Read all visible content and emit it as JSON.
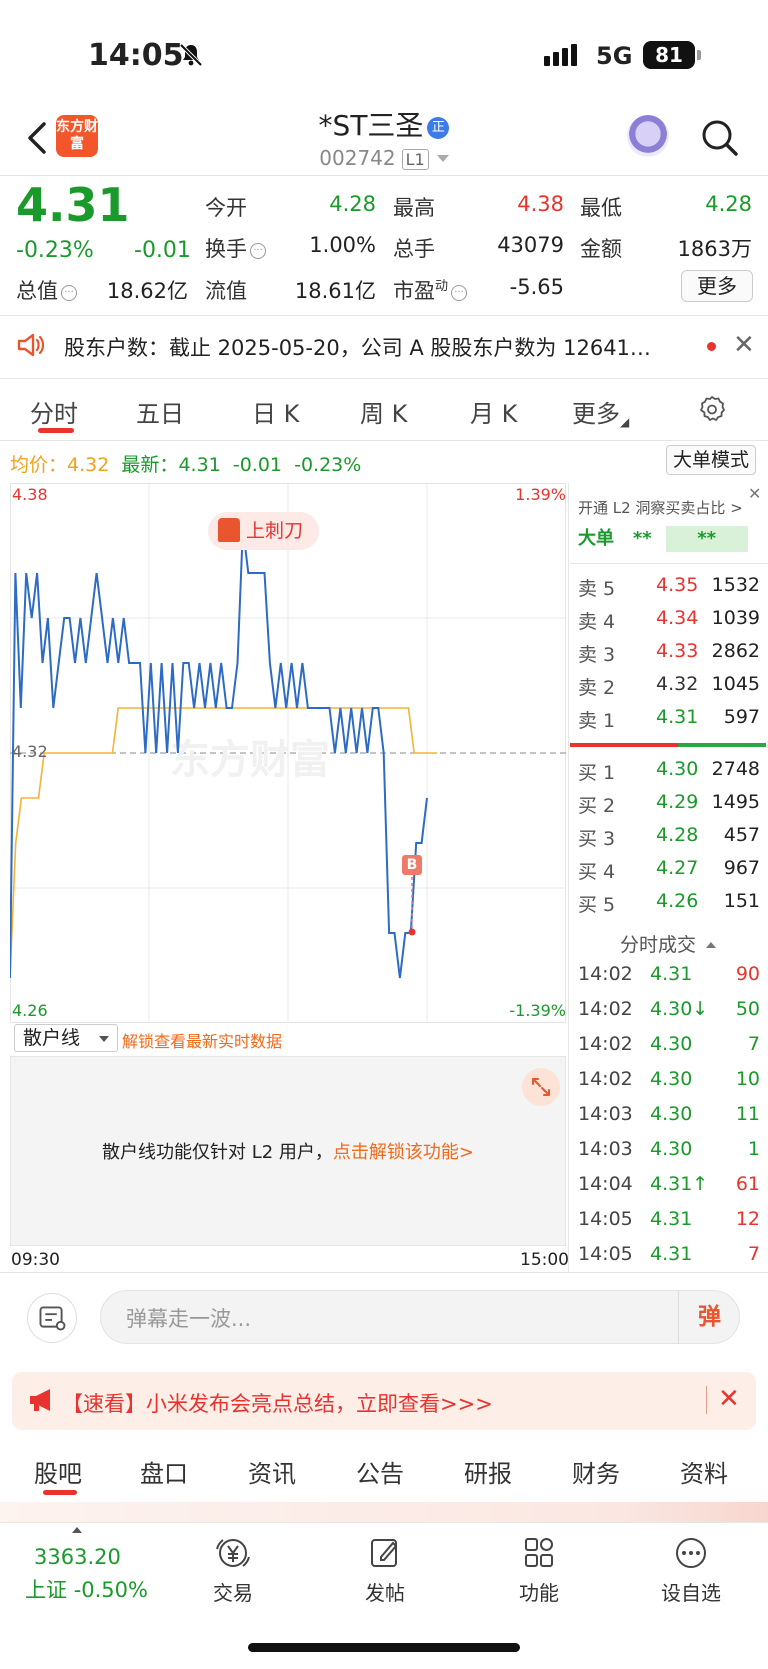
{
  "status_bar": {
    "time": "14:05",
    "network": "5G",
    "battery": "81"
  },
  "header": {
    "app_logo": "东方财富",
    "stock_name": "*ST三圣",
    "badge": "正",
    "stock_code": "002742",
    "level": "L1"
  },
  "quote": {
    "price": "4.31",
    "change_pct": "-0.23%",
    "change_abs": "-0.01",
    "open_label": "今开",
    "open": "4.28",
    "high_label": "最高",
    "high": "4.38",
    "low_label": "最低",
    "low": "4.28",
    "turnover_label": "换手",
    "turnover": "1.00%",
    "volume_label": "总手",
    "volume": "43079",
    "amount_label": "金额",
    "amount": "1863万",
    "mktcap_label": "总值",
    "mktcap": "18.62亿",
    "float_label": "流值",
    "float_cap": "18.61亿",
    "pe_label": "市盈",
    "pe_sup": "动",
    "pe": "-5.65",
    "more_label": "更多"
  },
  "notice": {
    "text": "股东户数：截止 2025-05-20，公司 A 股股东户数为 12641…"
  },
  "chart_tabs": [
    "分时",
    "五日",
    "日 K",
    "周 K",
    "月 K",
    "更多"
  ],
  "chart_header": {
    "avg_label": "均价：",
    "avg_value": "4.32",
    "latest_label": "最新：",
    "latest_value": "4.31",
    "latest_change": "-0.01",
    "latest_pct": "-0.23%",
    "big_order_mode": "大单模式"
  },
  "chart_data": {
    "type": "line",
    "y_high_label": "4.38",
    "y_low_label": "4.26",
    "y_mid_label": "4.32",
    "pct_high_label": "1.39%",
    "pct_low_label": "-1.39%",
    "ylim": [
      4.26,
      4.38
    ],
    "x_start_label": "09:30",
    "x_end_label": "15:00",
    "pattern_tag": "上刺刀",
    "marker_label": "B",
    "watermark": "东方财富",
    "series": [
      {
        "values": [
          4.27,
          4.36,
          4.33,
          4.36,
          4.35,
          4.36,
          4.34,
          4.35,
          4.33,
          4.34,
          4.35,
          4.35,
          4.34,
          4.35,
          4.34,
          4.35,
          4.36,
          4.35,
          4.34,
          4.35,
          4.34,
          4.35,
          4.34,
          4.34,
          4.34,
          4.32,
          4.34,
          4.32,
          4.34,
          4.32,
          4.34,
          4.32,
          4.34,
          4.34,
          4.33,
          4.34,
          4.33,
          4.34,
          4.33,
          4.34,
          4.33,
          4.33,
          4.34,
          4.37,
          4.36,
          4.36,
          4.36,
          4.36,
          4.34,
          4.33,
          4.34,
          4.33,
          4.34,
          4.33,
          4.34,
          4.33,
          4.33,
          4.33,
          4.33,
          4.33,
          4.32,
          4.33,
          4.32,
          4.33,
          4.32,
          4.33,
          4.32,
          4.33,
          4.33,
          4.32,
          4.28,
          4.28,
          4.27,
          4.28,
          4.28,
          4.3,
          4.3,
          4.31
        ]
      },
      {
        "values": [
          4.27,
          4.3,
          4.31,
          4.31,
          4.31,
          4.31,
          4.32,
          4.32,
          4.32,
          4.32,
          4.32,
          4.32,
          4.32,
          4.32,
          4.32,
          4.32,
          4.32,
          4.32,
          4.32,
          4.33,
          4.33,
          4.33,
          4.33,
          4.33,
          4.33,
          4.33,
          4.33,
          4.33,
          4.33,
          4.33,
          4.33,
          4.33,
          4.33,
          4.33,
          4.33,
          4.33,
          4.33,
          4.33,
          4.33,
          4.33,
          4.33,
          4.33,
          4.33,
          4.33,
          4.33,
          4.33,
          4.33,
          4.33,
          4.33,
          4.33,
          4.33,
          4.33,
          4.33,
          4.33,
          4.33,
          4.33,
          4.33,
          4.33,
          4.33,
          4.33,
          4.33,
          4.33,
          4.33,
          4.33,
          4.33,
          4.33,
          4.33,
          4.33,
          4.33,
          4.33,
          4.33,
          4.32,
          4.32,
          4.32,
          4.32,
          4.32
        ]
      }
    ]
  },
  "retail_line": {
    "select_label": "散户线",
    "unlock_hint": "解锁查看最新实时数据",
    "message": "散户线功能仅针对 L2 用户，",
    "message_link": "点击解锁该功能>"
  },
  "l2": {
    "title": "开通 L2 洞察买卖占比 >",
    "big_label": "大单",
    "big_a": "**",
    "big_b": "**"
  },
  "order_book": {
    "asks": [
      {
        "label": "卖 5",
        "price": "4.35",
        "vol": "1532"
      },
      {
        "label": "卖 4",
        "price": "4.34",
        "vol": "1039"
      },
      {
        "label": "卖 3",
        "price": "4.33",
        "vol": "2862"
      },
      {
        "label": "卖 2",
        "price": "4.32",
        "vol": "1045"
      },
      {
        "label": "卖 1",
        "price": "4.31",
        "vol": "597"
      }
    ],
    "bids": [
      {
        "label": "买 1",
        "price": "4.30",
        "vol": "2748"
      },
      {
        "label": "买 2",
        "price": "4.29",
        "vol": "1495"
      },
      {
        "label": "买 3",
        "price": "4.28",
        "vol": "457"
      },
      {
        "label": "买 4",
        "price": "4.27",
        "vol": "967"
      },
      {
        "label": "买 5",
        "price": "4.26",
        "vol": "151"
      }
    ]
  },
  "ticks": {
    "title": "分时成交",
    "rows": [
      {
        "time": "14:02",
        "price": "4.31",
        "vol": "90"
      },
      {
        "time": "14:02",
        "price": "4.30↓",
        "vol": "50"
      },
      {
        "time": "14:02",
        "price": "4.30",
        "vol": "7"
      },
      {
        "time": "14:02",
        "price": "4.30",
        "vol": "10"
      },
      {
        "time": "14:03",
        "price": "4.30",
        "vol": "11"
      },
      {
        "time": "14:03",
        "price": "4.30",
        "vol": "1"
      },
      {
        "time": "14:04",
        "price": "4.31↑",
        "vol": "61"
      },
      {
        "time": "14:05",
        "price": "4.31",
        "vol": "12"
      },
      {
        "time": "14:05",
        "price": "4.31",
        "vol": "7"
      }
    ]
  },
  "comment": {
    "placeholder": "弹幕走一波...",
    "send_label": "弹"
  },
  "promo": {
    "text": "【速看】小米发布会亮点总结，立即查看>>>"
  },
  "content_tabs": [
    "股吧",
    "盘口",
    "资讯",
    "公告",
    "研报",
    "财务",
    "资料"
  ],
  "bottom_nav": {
    "index_value": "3363.20",
    "index_name": "上证",
    "index_pct": "-0.50%",
    "items": [
      "交易",
      "发帖",
      "功能",
      "设自选"
    ]
  },
  "colors": {
    "up": "#e8332f",
    "down": "#1a9a2b",
    "price_line": "#2d6bc4",
    "avg_line": "#f5b335",
    "accent": "#f2562a"
  }
}
